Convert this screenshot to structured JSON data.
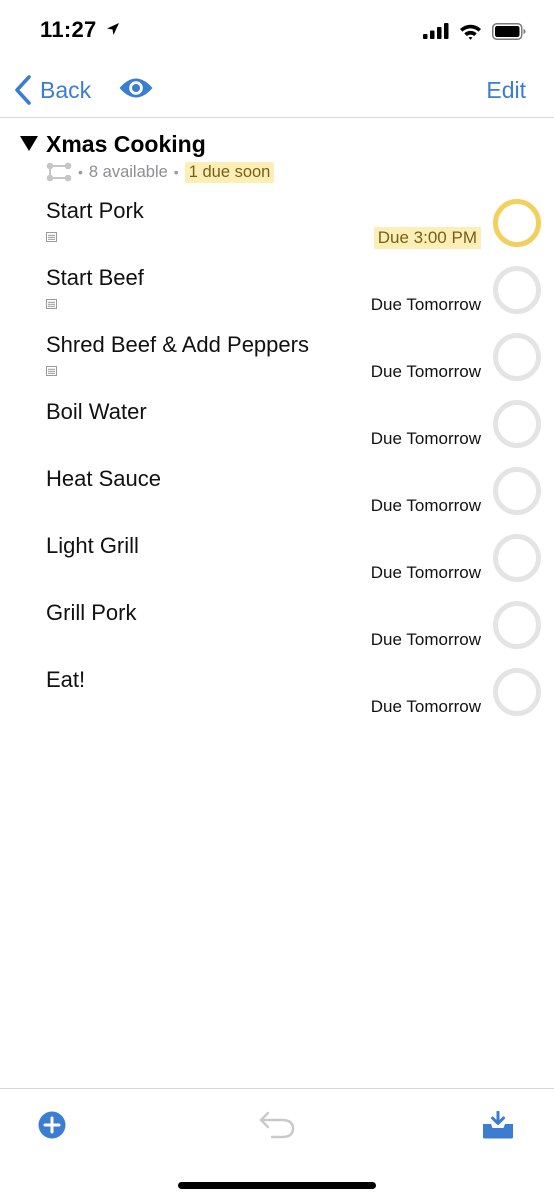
{
  "status": {
    "time": "11:27"
  },
  "nav": {
    "back_label": "Back",
    "edit_label": "Edit"
  },
  "group": {
    "title": "Xmas Cooking",
    "available": "8 available",
    "due_soon": "1 due soon"
  },
  "tasks": [
    {
      "title": "Start Pork",
      "due": "Due 3:00 PM",
      "has_note": true,
      "due_soon": true
    },
    {
      "title": "Start Beef",
      "due": "Due Tomorrow",
      "has_note": true,
      "due_soon": false
    },
    {
      "title": "Shred Beef & Add Peppers",
      "due": "Due Tomorrow",
      "has_note": true,
      "due_soon": false
    },
    {
      "title": "Boil Water",
      "due": "Due Tomorrow",
      "has_note": false,
      "due_soon": false
    },
    {
      "title": "Heat Sauce",
      "due": "Due Tomorrow",
      "has_note": false,
      "due_soon": false
    },
    {
      "title": "Light Grill",
      "due": "Due Tomorrow",
      "has_note": false,
      "due_soon": false
    },
    {
      "title": "Grill Pork",
      "due": "Due Tomorrow",
      "has_note": false,
      "due_soon": false
    },
    {
      "title": "Eat!",
      "due": "Due Tomorrow",
      "has_note": false,
      "due_soon": false
    }
  ],
  "icons": {
    "location": "location-arrow-icon",
    "signal": "cellular-signal-icon",
    "wifi": "wifi-icon",
    "battery": "battery-icon",
    "back": "chevron-left-icon",
    "eye": "eye-icon",
    "disclosure": "disclosure-triangle-icon",
    "project": "project-sequence-icon",
    "note": "note-icon",
    "add": "add-circle-icon",
    "undo": "undo-icon",
    "inbox": "inbox-icon"
  },
  "colors": {
    "accent": "#3b7ed1",
    "due_soon_bg": "#fbefb7",
    "due_soon_ring": "#f2d05d",
    "ring": "#e4e4e4"
  }
}
